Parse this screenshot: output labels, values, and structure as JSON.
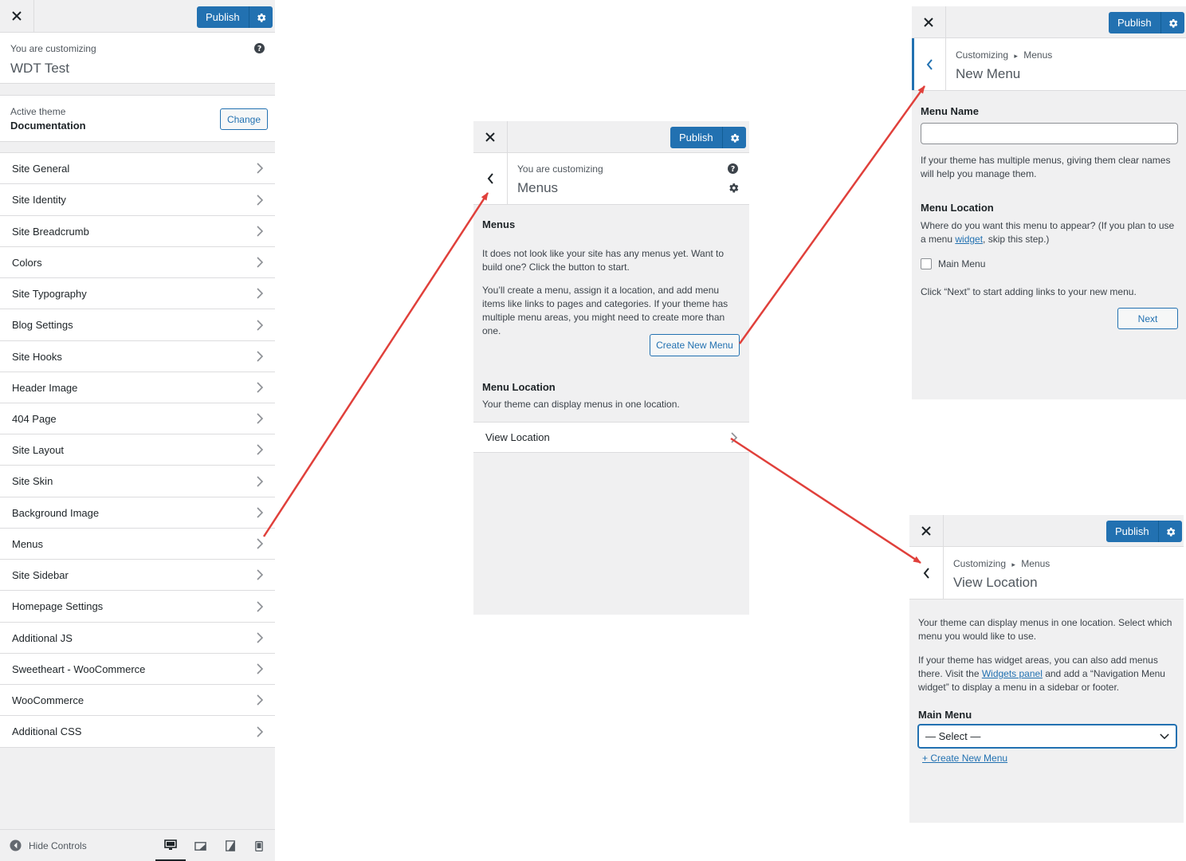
{
  "colors": {
    "accent": "#2271b1",
    "arrow": "#e0403b",
    "panel_bg": "#f0f0f1"
  },
  "panel_main": {
    "publish_label": "Publish",
    "customizing_label": "You are customizing",
    "site_title": "WDT Test",
    "active_theme_label": "Active theme",
    "theme_name": "Documentation",
    "change_label": "Change",
    "sections": [
      "Site General",
      "Site Identity",
      "Site Breadcrumb",
      "Colors",
      "Site Typography",
      "Blog Settings",
      "Site Hooks",
      "Header Image",
      "404 Page",
      "Site Layout",
      "Site Skin",
      "Background Image",
      "Menus",
      "Site Sidebar",
      "Homepage Settings",
      "Additional JS",
      "Sweetheart - WooCommerce",
      "WooCommerce",
      "Additional CSS"
    ],
    "hide_controls_label": "Hide Controls",
    "devices": [
      "desktop-icon",
      "tablet-landscape-icon",
      "tablet-icon",
      "mobile-icon"
    ]
  },
  "panel_menus": {
    "publish_label": "Publish",
    "customizing_label": "You are customizing",
    "title": "Menus",
    "heading": "Menus",
    "intro_text": "It does not look like your site has any menus yet. Want to build one? Click the button to start.",
    "detail_text": "You’ll create a menu, assign it a location, and add menu items like links to pages and categories. If your theme has multiple menu areas, you might need to create more than one.",
    "create_button": "Create New Menu",
    "location_heading": "Menu Location",
    "location_text": "Your theme can display menus in one location.",
    "view_location": "View Location"
  },
  "panel_new_menu": {
    "publish_label": "Publish",
    "breadcrumb_root": "Customizing",
    "breadcrumb_sep": "▸",
    "breadcrumb_current": "Menus",
    "title": "New Menu",
    "name_label": "Menu Name",
    "name_value": "",
    "name_help": "If your theme has multiple menus, giving them clear names will help you manage them.",
    "location_heading": "Menu Location",
    "location_help_pre": "Where do you want this menu to appear? (If you plan to use a menu ",
    "location_help_link": "widget",
    "location_help_post": ", skip this step.)",
    "checkbox_label": "Main Menu",
    "checkbox_checked": false,
    "next_help": "Click “Next” to start adding links to your new menu.",
    "next_button": "Next"
  },
  "panel_view_location": {
    "publish_label": "Publish",
    "breadcrumb_root": "Customizing",
    "breadcrumb_sep": "▸",
    "breadcrumb_current": "Menus",
    "title": "View Location",
    "text1": "Your theme can display menus in one location. Select which menu you would like to use.",
    "text2_pre": "If your theme has widget areas, you can also add menus there. Visit the ",
    "text2_link": "Widgets panel",
    "text2_post": " and add a “Navigation Menu widget” to display a menu in a sidebar or footer.",
    "select_label": "Main Menu",
    "select_value": "— Select —",
    "create_link": "+ Create New Menu"
  }
}
